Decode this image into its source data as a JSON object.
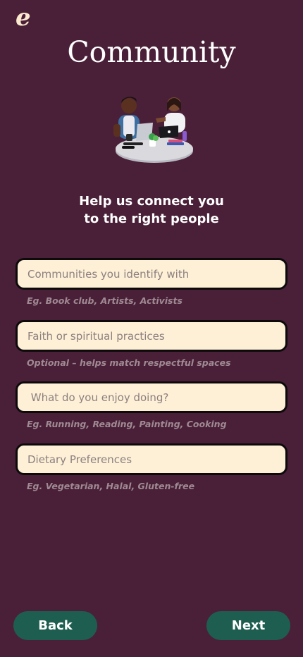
{
  "brand": {
    "logo_text": "e"
  },
  "header": {
    "title": "Community",
    "subtitle_line1": "Help us connect you",
    "subtitle_line2": "to the right people"
  },
  "illustration": {
    "icon": "people-working-with-laptops-illustration"
  },
  "form": {
    "fields": [
      {
        "placeholder": "Communities you identify with",
        "value": "",
        "hint": "Eg. Book club, Artists, Activists"
      },
      {
        "placeholder": "Faith or spiritual practices",
        "value": "",
        "hint": "Optional – helps match respectful spaces"
      },
      {
        "placeholder": " What do you enjoy doing?",
        "value": "",
        "hint": "Eg. Running, Reading, Painting, Cooking"
      },
      {
        "placeholder": "Dietary Preferences",
        "value": "",
        "hint": "Eg. Vegetarian, Halal, Gluten-free"
      }
    ]
  },
  "nav": {
    "back_label": "Back",
    "next_label": "Next"
  },
  "colors": {
    "background": "#4a2038",
    "field_fill": "#fdf0d6",
    "button": "#1e5e50",
    "hint_text": "#9f8a93"
  }
}
